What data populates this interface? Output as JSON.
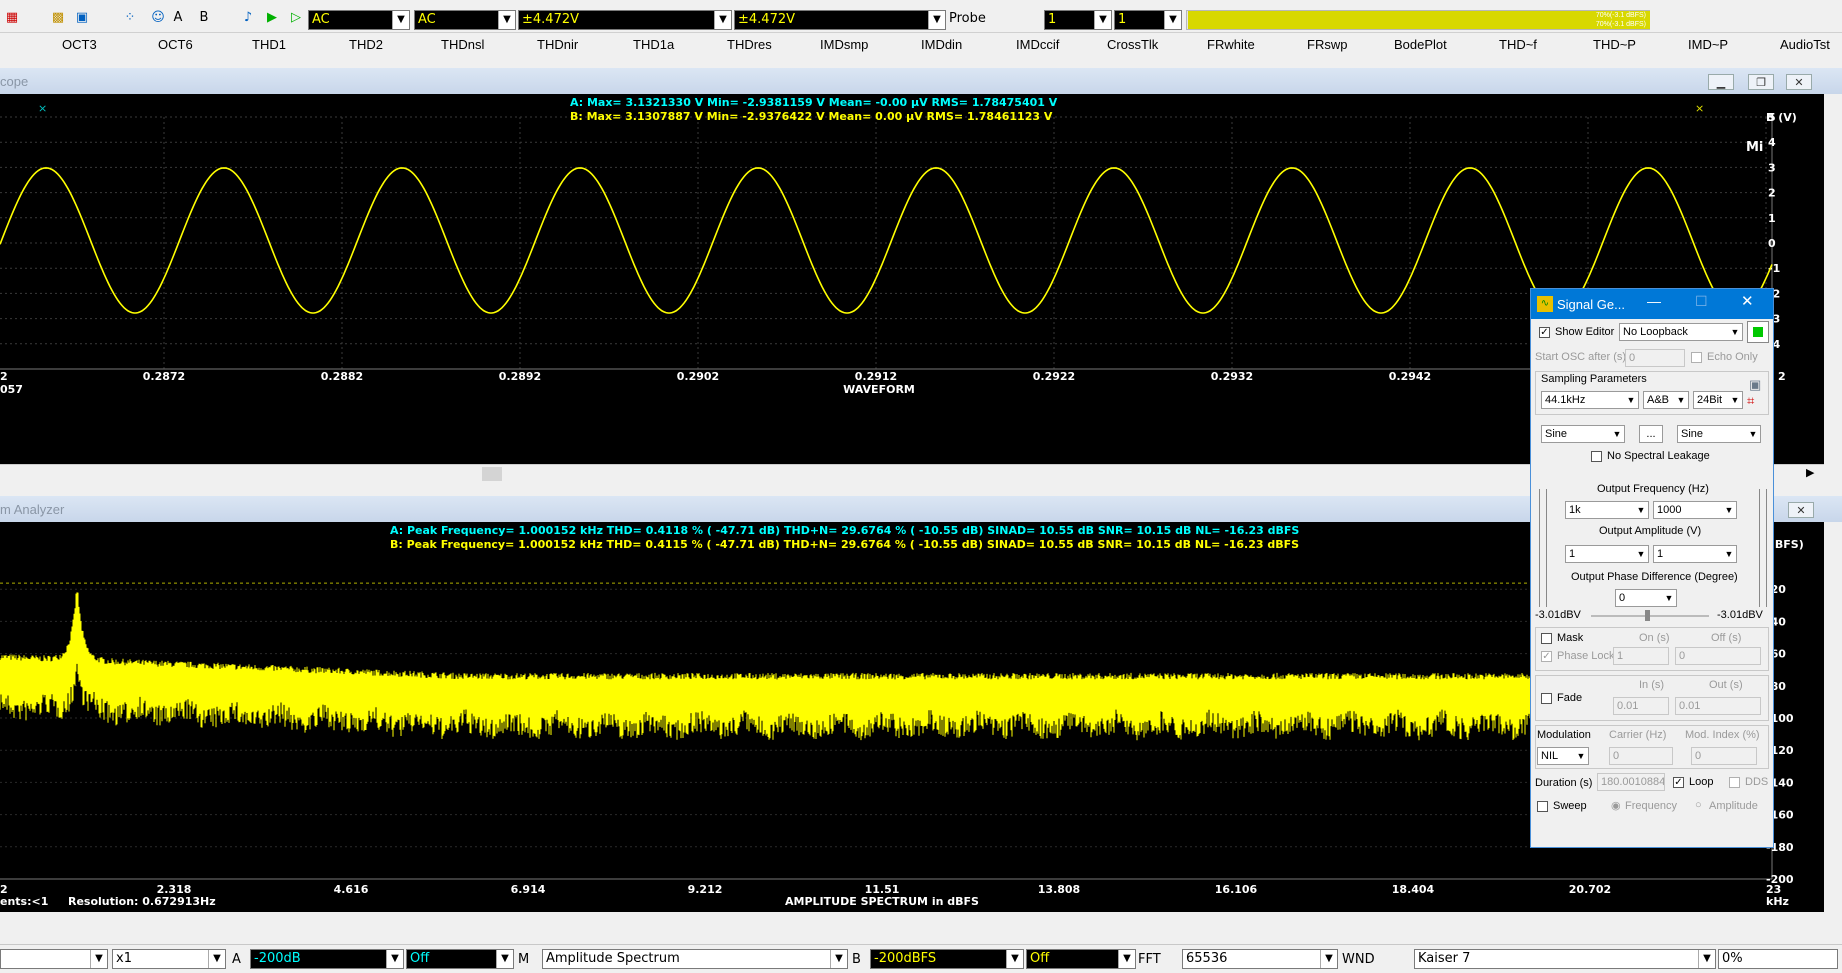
{
  "toolbar": {
    "combo1": "AC",
    "combo2": "AC",
    "combo3": "±4.472V",
    "combo4": "±4.472V",
    "probe_label": "Probe",
    "probe1": "1",
    "probe2": "1",
    "level_a": "70%(-3.1 dBFS)",
    "level_b": "70%(-3.1 dBFS)"
  },
  "menu": [
    "OCT3",
    "OCT6",
    "THD1",
    "THD2",
    "THDnsl",
    "THDnir",
    "THD1a",
    "THDres",
    "IMDsmp",
    "IMDdin",
    "IMDccif",
    "CrossTlk",
    "FRwhite",
    "FRswp",
    "BodePlot",
    "THD~f",
    "THD~P",
    "IMD~P",
    "AudioTst"
  ],
  "scope": {
    "title": "cope",
    "stat_a": "A: Max=    3.1321330   V  Min=   -2.9381159   V  Mean=           -0.00  µV  RMS=    1.78475401   V",
    "stat_b": "B: Max=    3.1307887   V  Min=   -2.9376422   V  Mean=            0.00  µV  RMS=    1.78461123   V",
    "y_unit": "B (V)",
    "y_ticks": [
      "5",
      "4",
      "3",
      "2",
      "1",
      "0",
      "-1",
      "-2",
      "-3",
      "-4"
    ],
    "x_ticks": [
      "0.2872",
      "0.2882",
      "0.2892",
      "0.2902",
      "0.2912",
      "0.2922",
      "0.2932",
      "0.2942"
    ],
    "x_left_1": "2",
    "x_left_2": "057",
    "x_right": "2",
    "x_label": "WAVEFORM",
    "mi_label": "Mi"
  },
  "spectrum": {
    "title": "m Analyzer",
    "stat_a": "A: Peak Frequency=   1.000152   kHz  THD=    0.4118 % (   -47.71 dB)  THD+N=   29.6764 % (   -10.55 dB)  SINAD=    10.55 dB  SNR=    10.15 dB  NL=   -16.23 dBFS",
    "stat_b": "B: Peak Frequency=   1.000152   kHz  THD=    0.4115 % (   -47.71 dB)  THD+N=   29.6764 % (   -10.55 dB)  SINAD=    10.55 dB  SNR=    10.15 dB  NL=   -16.23 dBFS",
    "y_unit": "(dBFS)",
    "y_ticks": [
      "-20",
      "-40",
      "-60",
      "-80",
      "-100",
      "-120",
      "-140",
      "-160",
      "-180",
      "-200"
    ],
    "x_ticks": [
      "2.318",
      "4.616",
      "6.914",
      "9.212",
      "11.51",
      "13.808",
      "16.106",
      "18.404",
      "20.702"
    ],
    "x_left": "2",
    "x_right": "23",
    "x_unit": "kHz",
    "x_label": "AMPLITUDE SPECTRUM in dBFS",
    "segments": "ents:<1",
    "resolution": "Resolution: 0.672913Hz"
  },
  "siggen": {
    "title": "Signal Ge...",
    "show_editor": "Show Editor",
    "loopback": "No Loopback",
    "start_osc": "Start OSC after (s)",
    "start_osc_val": "0",
    "echo_only": "Echo Only",
    "sampling_params": "Sampling Parameters",
    "rate": "44.1kHz",
    "channels": "A&B",
    "bits": "24Bit",
    "wave_a": "Sine",
    "wave_b": "Sine",
    "dots": "...",
    "no_leakage": "No Spectral Leakage",
    "out_freq": "Output Frequency (Hz)",
    "freq_a": "1k",
    "freq_b": "1000",
    "out_amp": "Output Amplitude (V)",
    "amp_a": "1",
    "amp_b": "1",
    "phase": "Output Phase Difference (Degree)",
    "phase_val": "0",
    "dbv_left": "-3.01dBV",
    "dbv_right": "-3.01dBV",
    "mask": "Mask",
    "on_s": "On (s)",
    "off_s": "Off (s)",
    "phase_lock": "Phase Lock",
    "on_val": "1",
    "off_val": "0",
    "fade": "Fade",
    "in_s": "In (s)",
    "out_s": "Out (s)",
    "in_val": "0.01",
    "out_val": "0.01",
    "modulation": "Modulation",
    "carrier": "Carrier (Hz)",
    "mod_index": "Mod. Index (%)",
    "mod_val": "NIL",
    "carrier_val": "0",
    "mod_index_val": "0",
    "duration": "Duration (s)",
    "duration_val": "180.0010884",
    "loop": "Loop",
    "dds": "DDS",
    "sweep": "Sweep",
    "frequency": "Frequency",
    "amplitude": "Amplitude"
  },
  "bottom": {
    "mult": "x1",
    "a_label": "A",
    "a_db": "-200dB",
    "a_off": "Off",
    "m_label": "M",
    "mode": "Amplitude Spectrum",
    "b_label": "B",
    "b_db": "-200dBFS",
    "b_off": "Off",
    "fft_label": "FFT",
    "fft_val": "65536",
    "wnd_label": "WND",
    "wnd_val": "Kaiser 7",
    "pct": "0%"
  },
  "colors": {
    "trace": "#ffff00",
    "stat_a": "#ffff00",
    "stat_b": "#00ffff",
    "accent": "#0078d7"
  }
}
